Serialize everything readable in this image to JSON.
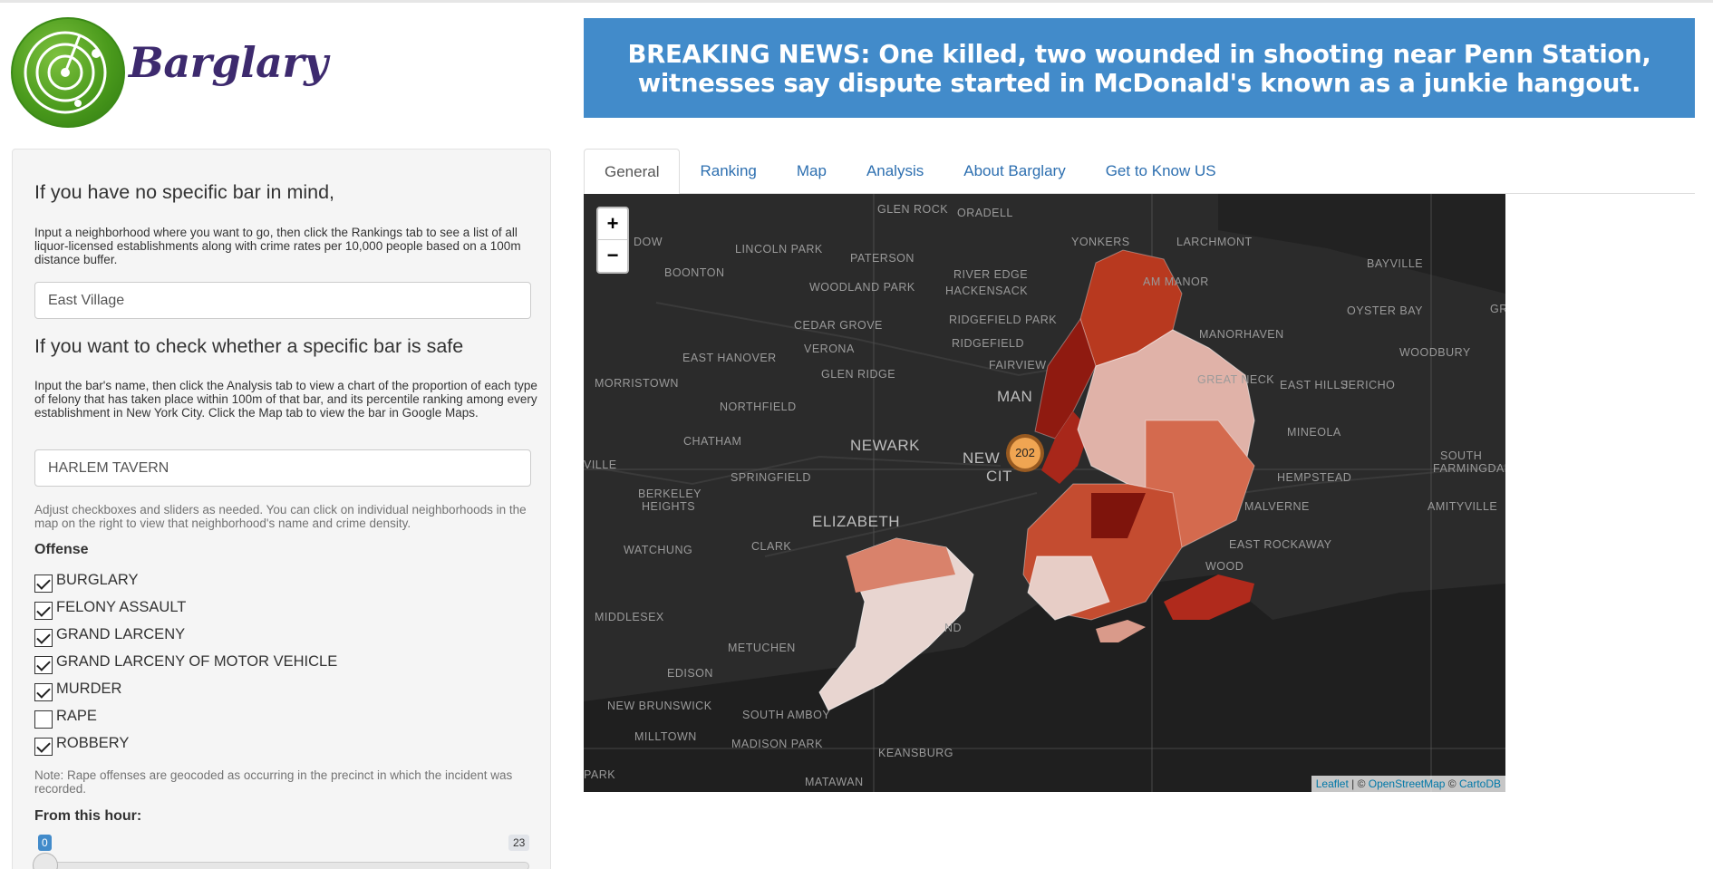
{
  "brand": {
    "name": "Barglary"
  },
  "banner": {
    "line1": "BREAKING NEWS: One killed, two wounded in shooting near Penn Station,",
    "line2": "witnesses say dispute started in McDonald's known as a junkie hangout."
  },
  "sidebar": {
    "heading1": "If you have no specific bar in mind,",
    "help1": "Input a neighborhood where you want to go, then click the Rankings tab to see a list of all liquor-licensed establishments along with crime rates per 10,000 people based on a 100m distance buffer.",
    "neighborhood_value": "East Village",
    "heading2": "If you want to check whether a specific bar is safe",
    "help2": "Input the bar's name, then click the Analysis tab to view a chart of the proportion of each type of felony that has taken place within 100m of that bar, and its percentile ranking among every establishment in New York City. Click the Map tab to view the bar in Google Maps.",
    "bar_value": "HARLEM TAVERN",
    "adjust_note": "Adjust checkboxes and sliders as needed. You can click on individual neighborhoods in the map on the right to view that neighborhood's name and crime density.",
    "offense_label": "Offense",
    "offenses": [
      {
        "label": "BURGLARY",
        "checked": true
      },
      {
        "label": "FELONY ASSAULT",
        "checked": true
      },
      {
        "label": "GRAND LARCENY",
        "checked": true
      },
      {
        "label": "GRAND LARCENY OF MOTOR VEHICLE",
        "checked": true
      },
      {
        "label": "MURDER",
        "checked": true
      },
      {
        "label": "RAPE",
        "checked": false
      },
      {
        "label": "ROBBERY",
        "checked": true
      }
    ],
    "rape_note": "Note: Rape offenses are geocoded as occurring in the precinct in which the incident was recorded.",
    "hour_label": "From this hour:",
    "hour_slider": {
      "min_label": "0",
      "max_label": "23",
      "value": 0
    }
  },
  "tabs": [
    "General",
    "Ranking",
    "Map",
    "Analysis",
    "About Barglary",
    "Get to Know US"
  ],
  "active_tab": "General",
  "map": {
    "zoom_in": "+",
    "zoom_out": "−",
    "cluster_count": "202",
    "labels": [
      "GLEN ROCK",
      "ORADELL",
      "YONKERS",
      "LARCHMONT",
      "BAYVILLE",
      "LINCOLN PARK",
      "PATERSON",
      "RIVER EDGE",
      "AM MANOR",
      "BOONTON",
      "WOODLAND PARK",
      "HACKENSACK",
      "OYSTER BAY",
      "CEDAR GROVE",
      "RIDGEFIELD PARK",
      "MANORHAVEN",
      "WOODBURY",
      "VERONA",
      "RIDGEFIELD",
      "EAST HANOVER",
      "FAIRVIEW",
      "GLEN RIDGE",
      "GREAT NECK",
      "MORRISTOWN",
      "EAST HILLS",
      "JERICHO",
      "NORTHFIELD",
      "MINEOLA",
      "CHATHAM",
      "NEWARK",
      "SOUTH",
      "FARMINGDALE",
      "SPRINGFIELD",
      "HEMPSTEAD",
      "BERKELEY",
      "HEIGHTS",
      "ELIZABETH",
      "MALVERNE",
      "AMITYVILLE",
      "CLARK",
      "EAST ROCKAWAY",
      "WATCHUNG",
      "WOOD",
      "MIDDLESEX",
      "METUCHEN",
      "EDISON",
      "NEW BRUNSWICK",
      "SOUTH AMBOY",
      "MILLTOWN",
      "MADISON PARK",
      "KEANSBURG",
      "MATAWAN",
      "DOW",
      "GRE",
      "VILLE",
      "PARK",
      "NEW",
      "CIT",
      "MAN",
      "ND"
    ],
    "attribution": {
      "leaflet": "Leaflet",
      "sep1": " | © ",
      "osm": "OpenStreetMap",
      "sep2": " © ",
      "carto": "CartoDB"
    }
  },
  "colors": {
    "accent": "#428bca",
    "brand_text": "#3d2a6e",
    "logo_green": "#4a9a1c",
    "map_bg": "#262626"
  }
}
